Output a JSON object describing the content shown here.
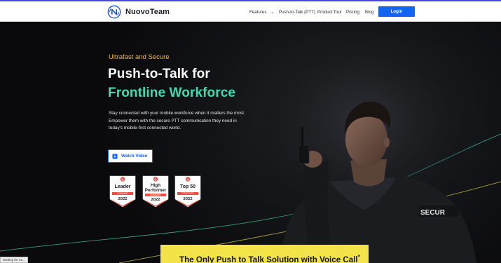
{
  "brand": {
    "name": "NuovoTeam",
    "logo_icon": "nuovoteam-logo-icon",
    "accent_color": "#1463f3"
  },
  "nav": {
    "items": [
      {
        "label": "Features",
        "has_dropdown": true
      },
      {
        "label": "Push-to-Talk (PTT)"
      },
      {
        "label": "Product Tour"
      },
      {
        "label": "Pricing"
      },
      {
        "label": "Blog"
      }
    ],
    "login_label": "Login"
  },
  "hero": {
    "eyebrow": "Ultrafast and Secure",
    "headline_line1": "Push-to-Talk for",
    "headline_line2": "Frontline Workforce",
    "description": "Stay connected with your mobile workforce when it matters the most. Empower them with the secure PTT communication they need in today's mobile-first connected world.",
    "watch_video_label": "Watch Video",
    "image_text": "SECUR",
    "colors": {
      "eyebrow": "#f4b73d",
      "headline_accent": "#43d9b1"
    }
  },
  "badges": [
    {
      "title_line1": "Leader",
      "title_line2": "",
      "season": "SUMMER",
      "year": "2022"
    },
    {
      "title_line1": "High",
      "title_line2": "Performer",
      "season": "SUMMER",
      "year": "2022"
    },
    {
      "title_line1": "Top 50",
      "title_line2": "",
      "season": "Collaboration Products",
      "year": "2022"
    }
  ],
  "cta": {
    "text": "The Only Push to Talk Solution with Voice Call",
    "superscript": "*",
    "background": "#f1e348"
  },
  "status": {
    "text": "Waiting for nu..."
  }
}
